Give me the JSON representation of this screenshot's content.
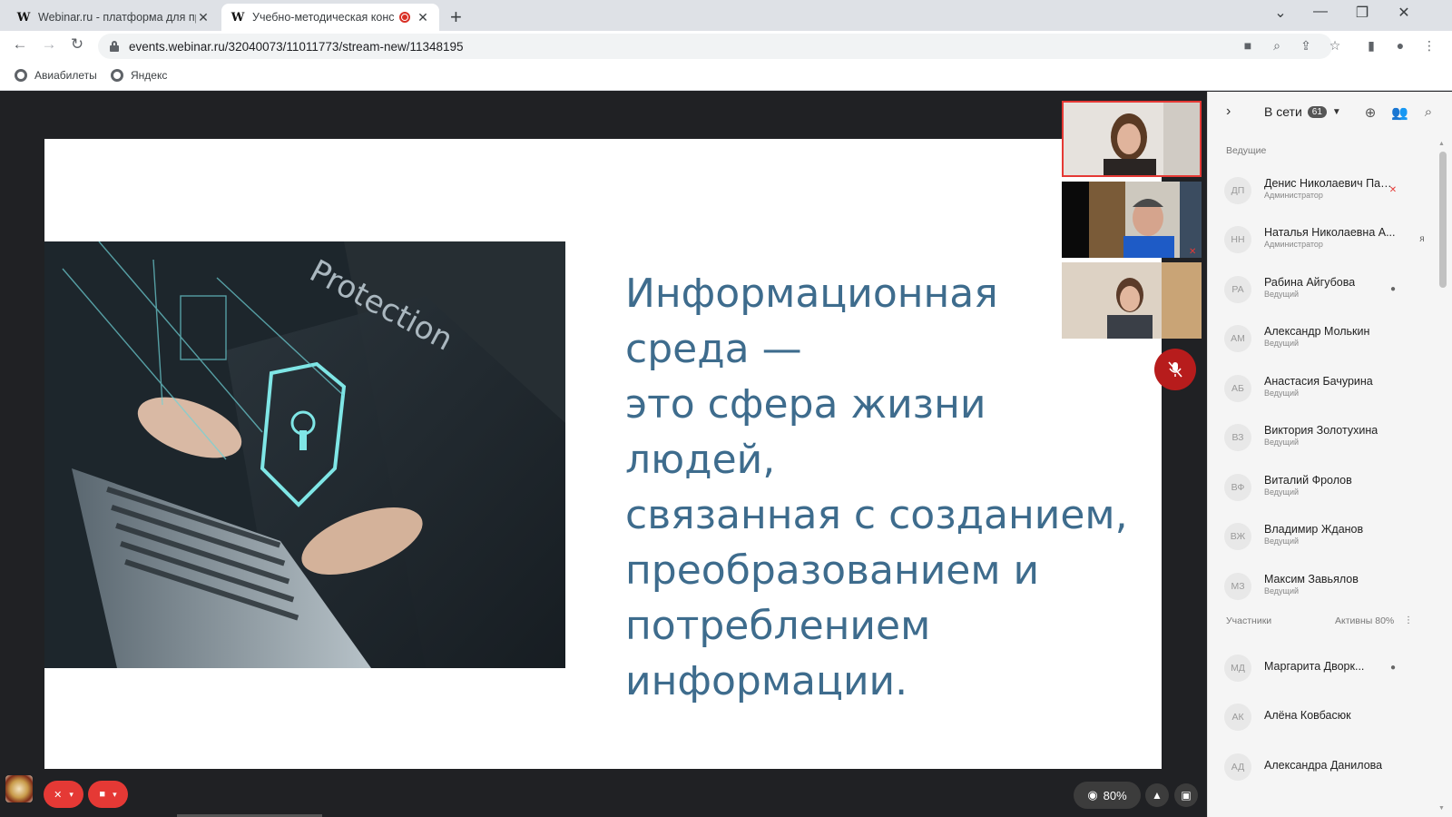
{
  "browser": {
    "tabs": [
      {
        "favicon": "W",
        "title": "Webinar.ru - платформа для про",
        "close": "✕"
      },
      {
        "favicon": "W",
        "title": "Учебно-методическая конс",
        "close": "✕"
      }
    ],
    "new_tab": "+",
    "window_controls": {
      "minimize": "—",
      "restore": "❐",
      "close": "✕",
      "tab_search": "⌄"
    },
    "url": "events.webinar.ru/32040073/11011773/stream-new/11348195",
    "bookmarks": [
      {
        "label": "Авиабилеты"
      },
      {
        "label": "Яндекс"
      }
    ]
  },
  "slide": {
    "text": "Информационная среда —\nэто сфера жизни людей,\nсвязанная с созданием,\nпреобразованием и\nпотреблением\nинформации.",
    "image_word": "Protection"
  },
  "controls": {
    "view_percent": "80%"
  },
  "panel": {
    "title": "В сети",
    "online_count": "61",
    "hosts_label": "Ведущие",
    "participants_label": "Участники",
    "active_label": "Активны 80%",
    "hosts": [
      {
        "initials": "ДП",
        "name": "Денис Николаевич Пашков",
        "role": "Администратор",
        "status": "muted"
      },
      {
        "initials": "НН",
        "name": "Наталья Николаевна А...",
        "role": "Администратор",
        "status": "me",
        "me_label": "я"
      },
      {
        "initials": "РА",
        "name": "Рабина Айгубова",
        "role": "Ведущий",
        "status": "mic"
      },
      {
        "initials": "АМ",
        "name": "Александр Молькин",
        "role": "Ведущий",
        "status": ""
      },
      {
        "initials": "АБ",
        "name": "Анастасия Бачурина",
        "role": "Ведущий",
        "status": ""
      },
      {
        "initials": "ВЗ",
        "name": "Виктория Золотухина",
        "role": "Ведущий",
        "status": ""
      },
      {
        "initials": "ВФ",
        "name": "Виталий Фролов",
        "role": "Ведущий",
        "status": ""
      },
      {
        "initials": "ВЖ",
        "name": "Владимир Жданов",
        "role": "Ведущий",
        "status": ""
      },
      {
        "initials": "МЗ",
        "name": "Максим Завьялов",
        "role": "Ведущий",
        "status": ""
      }
    ],
    "participants": [
      {
        "initials": "МД",
        "name": "Маргарита Дворк...",
        "status": "mic"
      },
      {
        "initials": "АК",
        "name": "Алёна Ковбасюк",
        "status": ""
      },
      {
        "initials": "АД",
        "name": "Александра Данилова",
        "status": ""
      }
    ]
  },
  "colors": {
    "slide_text": "#3e6c8d",
    "accent_red": "#e53935",
    "stage_bg": "#202124"
  }
}
